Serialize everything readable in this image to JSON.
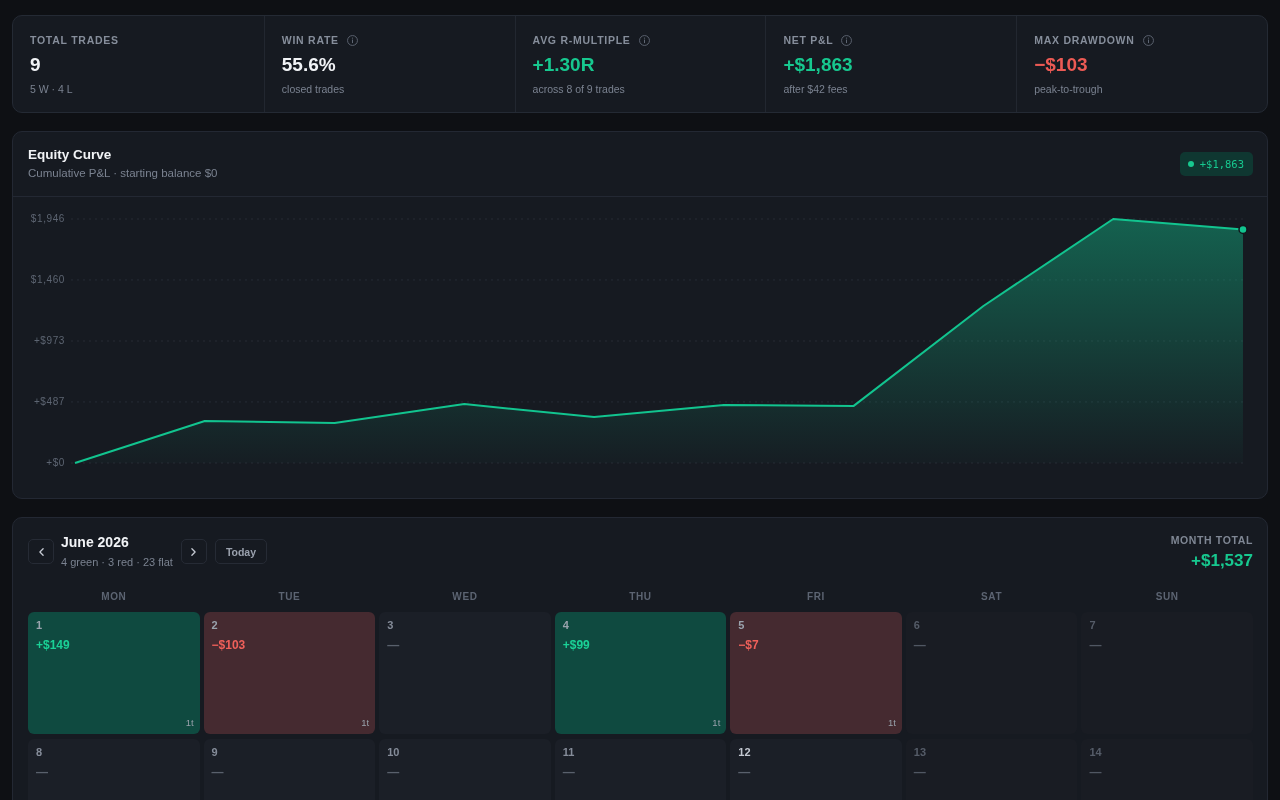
{
  "stats": [
    {
      "label": "TOTAL TRADES",
      "info": false,
      "value": "9",
      "color": "#f1f3f6",
      "note": "5 W · 4 L"
    },
    {
      "label": "WIN RATE",
      "info": true,
      "value": "55.6%",
      "color": "#f1f3f6",
      "note": "closed trades"
    },
    {
      "label": "AVG R-MULTIPLE",
      "info": true,
      "value": "+1.30R",
      "color": "#17c88f",
      "note": "across 8 of 9 trades"
    },
    {
      "label": "NET P&L",
      "info": true,
      "value": "+$1,863",
      "color": "#17c88f",
      "note": "after $42 fees"
    },
    {
      "label": "MAX DRAWDOWN",
      "info": true,
      "value": "−$103",
      "color": "#ec5a54",
      "note": "peak-to-trough"
    }
  ],
  "equity_curve": {
    "title": "Equity Curve",
    "subtitle": "Cumulative P&L · starting balance $0",
    "badge": "+$1,863",
    "chart_data": {
      "type": "area",
      "grid": true,
      "series": [
        {
          "color": "#12c48f",
          "values": [
            0,
            335,
            319,
            470,
            367,
            463,
            455,
            1252,
            1946,
            1863
          ]
        }
      ],
      "ylim": [
        0,
        1946
      ],
      "yticks": [
        {
          "value": 1946,
          "label": "$1,946"
        },
        {
          "value": 1460,
          "label": "$1,460"
        },
        {
          "value": 973,
          "label": "+$973"
        },
        {
          "value": 487,
          "label": "+$487"
        },
        {
          "value": 0,
          "label": "+$0"
        }
      ]
    }
  },
  "calendar": {
    "title": "June 2026",
    "summary": "4 green · 3 red · 23 flat",
    "today_button": "Today",
    "total_label": "MONTH TOTAL",
    "total": "+$1,537",
    "weekdays": [
      "MON",
      "TUE",
      "WED",
      "THU",
      "FRI",
      "SAT",
      "SUN"
    ],
    "weeks": [
      [
        {
          "day": "1",
          "kind": "win",
          "amount": "+$149",
          "trades": "1t",
          "weekend": false,
          "today": false
        },
        {
          "day": "2",
          "kind": "loss",
          "amount": "−$103",
          "trades": "1t",
          "weekend": false,
          "today": false
        },
        {
          "day": "3",
          "kind": "flat",
          "amount": "—",
          "weekend": false,
          "today": false
        },
        {
          "day": "4",
          "kind": "win",
          "amount": "+$99",
          "trades": "1t",
          "weekend": false,
          "today": false
        },
        {
          "day": "5",
          "kind": "loss",
          "amount": "−$7",
          "trades": "1t",
          "weekend": false,
          "today": false
        },
        {
          "day": "6",
          "kind": "flat",
          "amount": "—",
          "weekend": true,
          "today": false
        },
        {
          "day": "7",
          "kind": "flat",
          "amount": "—",
          "weekend": true,
          "today": false
        }
      ],
      [
        {
          "day": "8",
          "kind": "flat",
          "amount": "—",
          "weekend": false,
          "today": false
        },
        {
          "day": "9",
          "kind": "flat",
          "amount": "—",
          "weekend": false,
          "today": false
        },
        {
          "day": "10",
          "kind": "flat",
          "amount": "—",
          "weekend": false,
          "today": false
        },
        {
          "day": "11",
          "kind": "flat",
          "amount": "—",
          "weekend": false,
          "today": false
        },
        {
          "day": "12",
          "kind": "flat",
          "amount": "—",
          "weekend": false,
          "today": true
        },
        {
          "day": "13",
          "kind": "flat",
          "amount": "—",
          "weekend": true,
          "today": false
        },
        {
          "day": "14",
          "kind": "flat",
          "amount": "—",
          "weekend": true,
          "today": false
        }
      ]
    ]
  }
}
